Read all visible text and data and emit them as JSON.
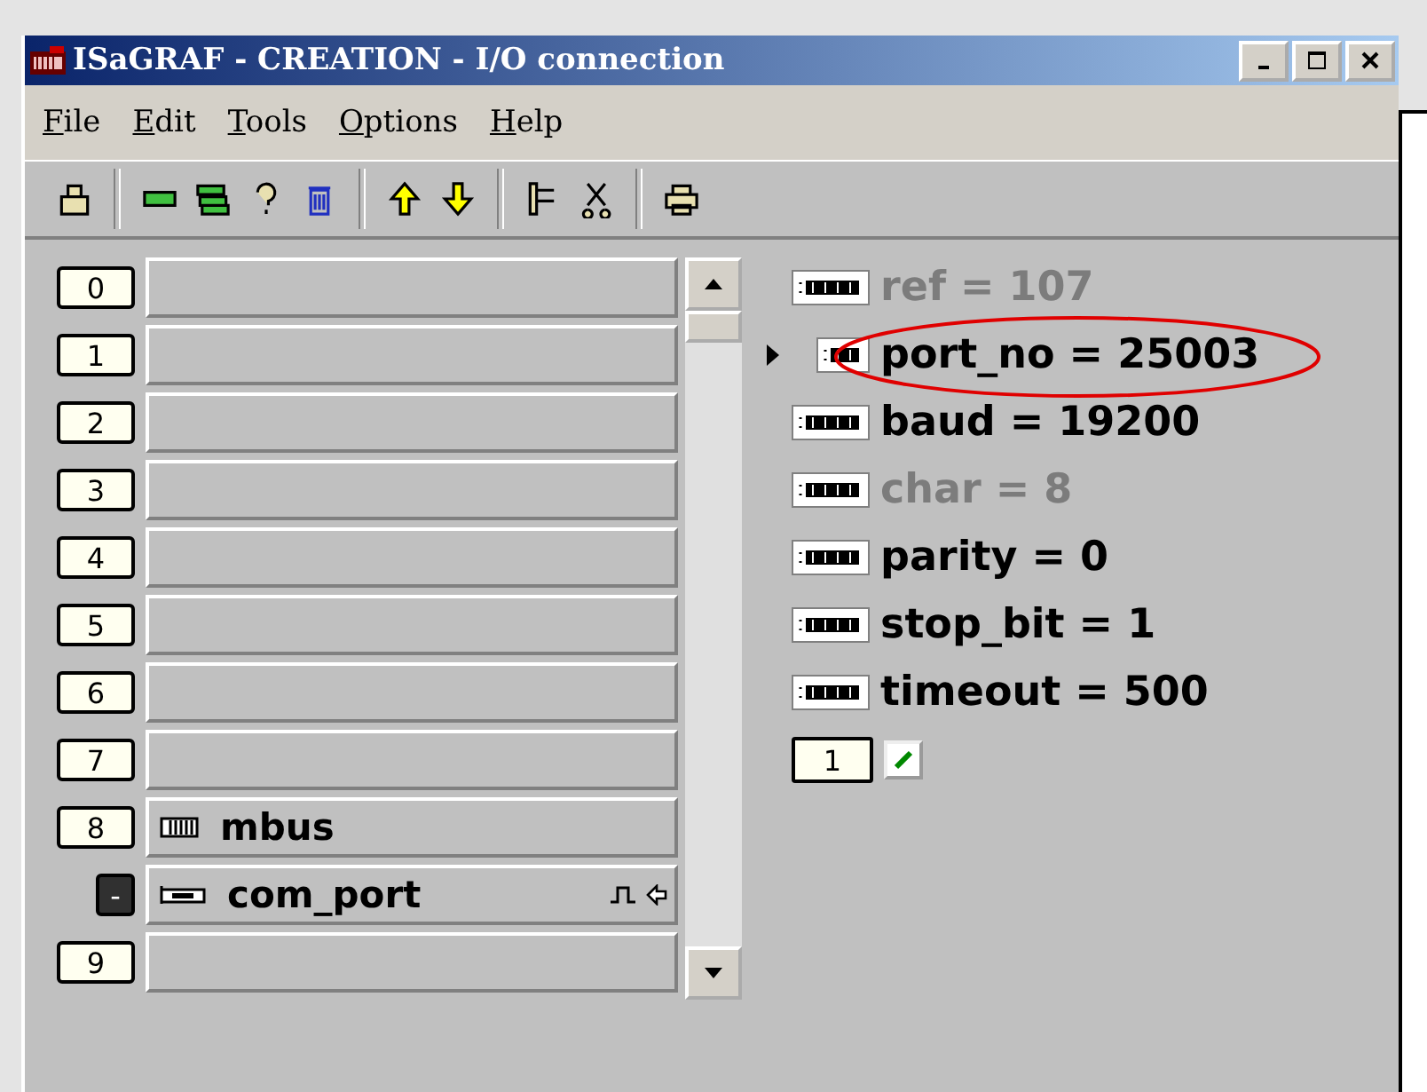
{
  "window": {
    "title": "ISaGRAF - CREATION - I/O connection"
  },
  "menu": [
    {
      "label": "File"
    },
    {
      "label": "Edit"
    },
    {
      "label": "Tools"
    },
    {
      "label": "Options"
    },
    {
      "label": "Help"
    }
  ],
  "slots": [
    {
      "label": "0",
      "kind": "empty"
    },
    {
      "label": "1",
      "kind": "empty"
    },
    {
      "label": "2",
      "kind": "empty"
    },
    {
      "label": "3",
      "kind": "empty"
    },
    {
      "label": "4",
      "kind": "empty"
    },
    {
      "label": "5",
      "kind": "empty"
    },
    {
      "label": "6",
      "kind": "empty"
    },
    {
      "label": "7",
      "kind": "empty"
    },
    {
      "label": "8",
      "kind": "board",
      "name": "mbus"
    },
    {
      "label": "-",
      "kind": "device",
      "name": "com_port"
    },
    {
      "label": "9",
      "kind": "empty"
    }
  ],
  "parameters": [
    {
      "text": "ref = 107",
      "dimmed": true,
      "selected": false
    },
    {
      "text": "port_no = 25003",
      "dimmed": false,
      "selected": true
    },
    {
      "text": "baud = 19200",
      "dimmed": false,
      "selected": false
    },
    {
      "text": "char = 8",
      "dimmed": true,
      "selected": false
    },
    {
      "text": "parity = 0",
      "dimmed": false,
      "selected": false
    },
    {
      "text": "stop_bit = 1",
      "dimmed": false,
      "selected": false
    },
    {
      "text": "timeout = 500",
      "dimmed": false,
      "selected": false
    }
  ],
  "channel_counter": "1"
}
